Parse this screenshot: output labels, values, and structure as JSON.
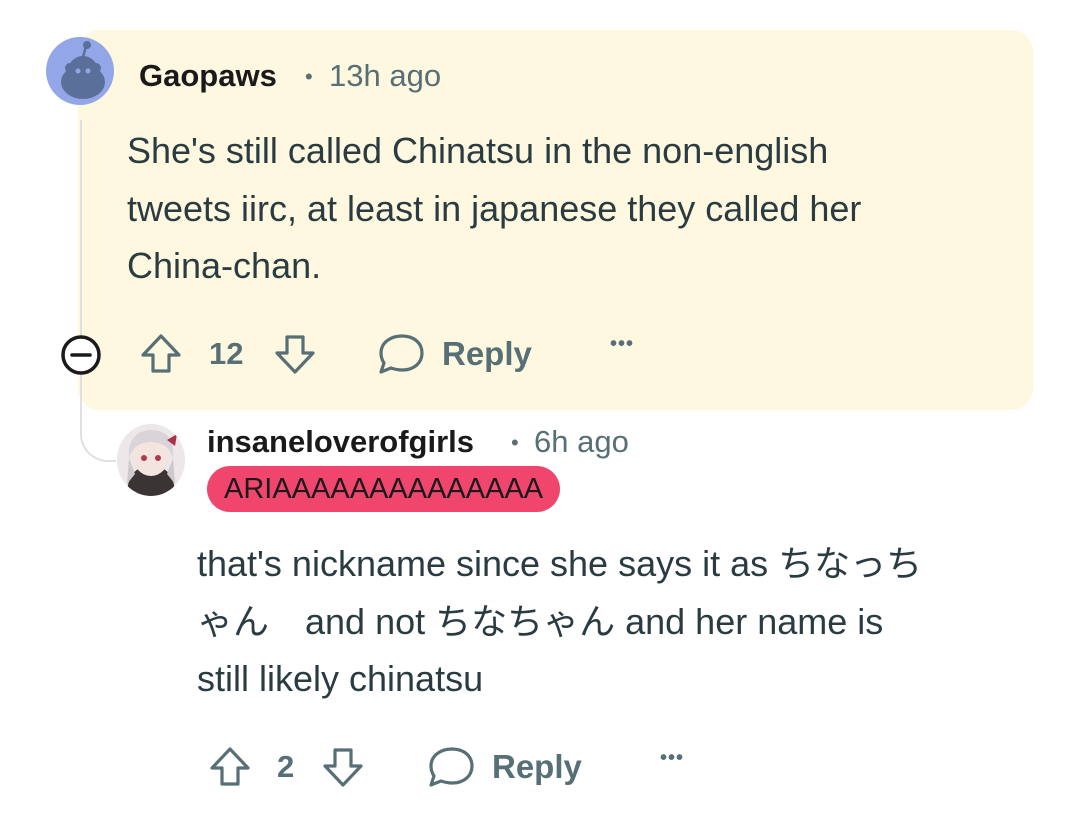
{
  "comments": [
    {
      "username": "Gaopaws",
      "separator": "•",
      "time": "13h ago",
      "body_lines": [
        "She's still called Chinatsu in the non-english",
        "tweets iirc, at least in japanese they called her",
        "China-chan."
      ],
      "score": "12",
      "reply_label": "Reply",
      "more_label": "•••",
      "avatar_icon": "snoo-avatar-icon",
      "highlight_color": "#fdf8df"
    },
    {
      "username": "insaneloverofgirls",
      "separator": "•",
      "time": "6h ago",
      "flair": "ARIAAAAAAAAAAAAAA",
      "flair_color": "#f0466e",
      "body_lines": [
        "that's nickname since she says it as ちなっち",
        "ゃん　and not ちなちゃん and her name is",
        "still likely chinatsu"
      ],
      "score": "2",
      "reply_label": "Reply",
      "more_label": "•••",
      "avatar_icon": "anime-avatar-icon"
    }
  ],
  "collapse_icon": "minus-circle-icon",
  "colors": {
    "meta_gray": "#576f76",
    "text_dark": "#2a3c42"
  }
}
